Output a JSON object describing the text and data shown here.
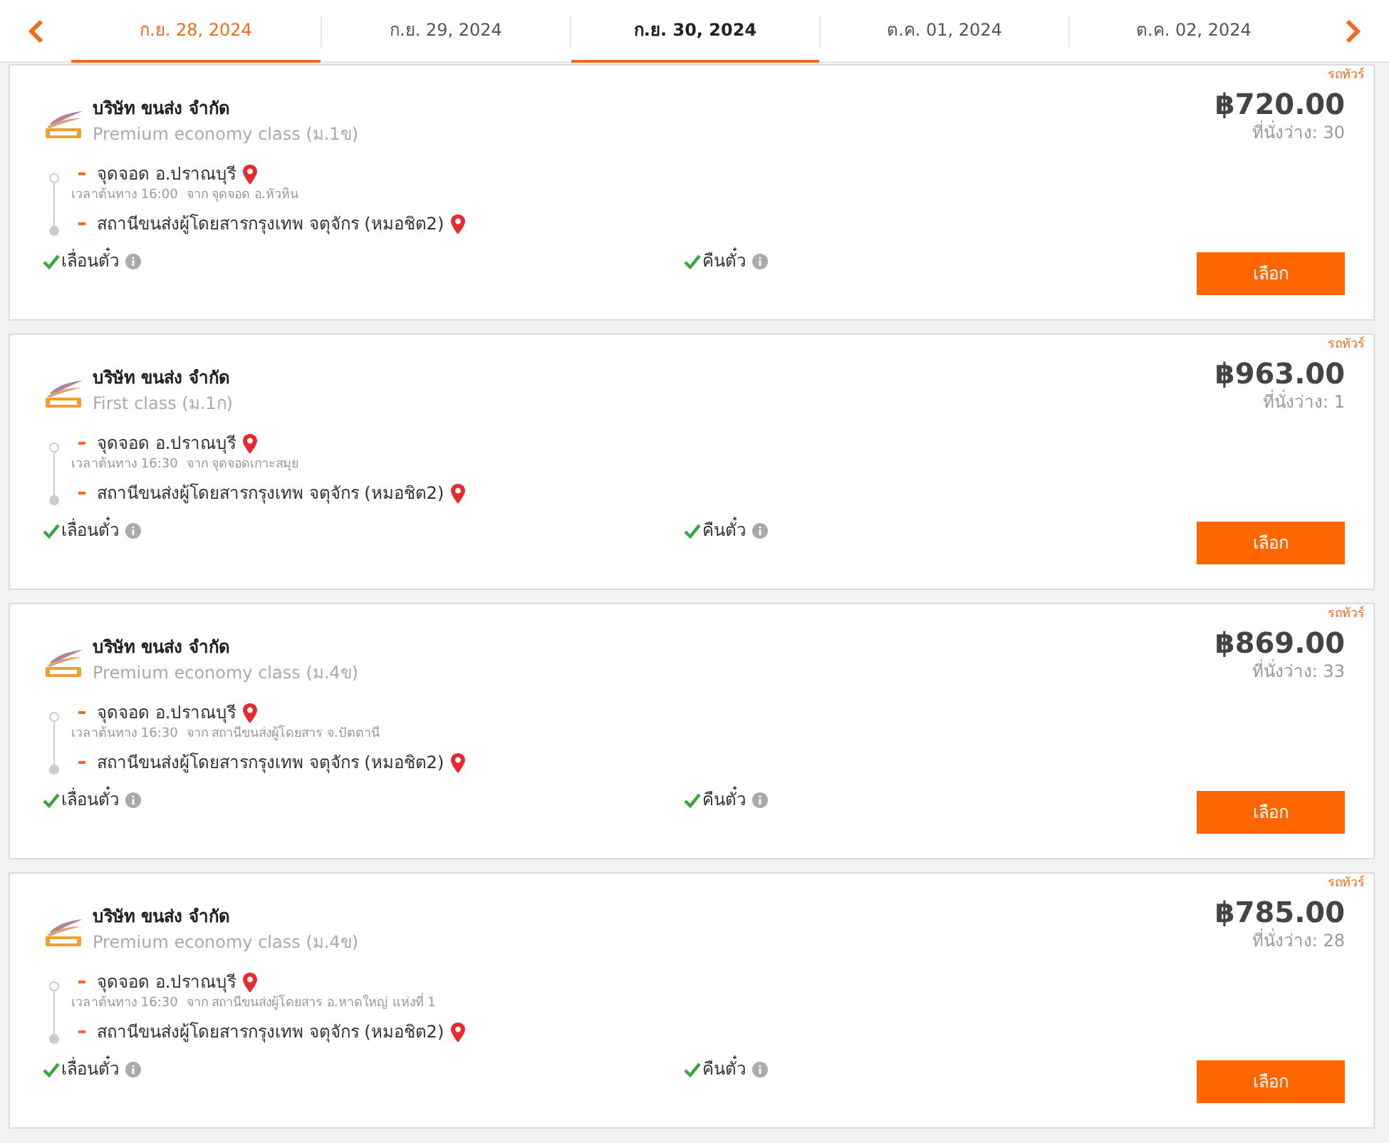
{
  "date_tabs": [
    {
      "label": "ก.ย. 28, 2024",
      "selected": false,
      "highlighted": true
    },
    {
      "label": "ก.ย. 29, 2024",
      "selected": false,
      "highlighted": false
    },
    {
      "label": "ก.ย. 30, 2024",
      "selected": true,
      "highlighted": false
    },
    {
      "label": "ต.ค. 01, 2024",
      "selected": false,
      "highlighted": false
    },
    {
      "label": "ต.ค. 02, 2024",
      "selected": false,
      "highlighted": false
    }
  ],
  "trips": [
    {
      "tag": "รถทัวร์",
      "company": "บริษัท ขนส่ง จำกัด",
      "class": "Premium economy class (ม.1ข)",
      "price": "฿720.00",
      "seats": "ที่นั่งว่าง: 30",
      "origin": "จุดจอด อ.ปราณบุรี",
      "departure": "เวลาต้นทาง 16:00",
      "from": "จาก จุดจอด อ.หัวหิน",
      "destination": "สถานีขนส่งผู้โดยสารกรุงเทพ จตุจักร (หมอชิต2)",
      "features": [
        {
          "label": "เลื่อนตั๋ว",
          "checked": true
        },
        {
          "label": "คืนตั๋ว",
          "checked": true
        }
      ],
      "button": "เลือก"
    },
    {
      "tag": "รถทัวร์",
      "company": "บริษัท ขนส่ง จำกัด",
      "class": "First class (ม.1ก)",
      "price": "฿963.00",
      "seats": "ที่นั่งว่าง: 1",
      "origin": "จุดจอด อ.ปราณบุรี",
      "departure": "เวลาต้นทาง 16:30",
      "from": "จาก จุดจอดเกาะสมุย",
      "destination": "สถานีขนส่งผู้โดยสารกรุงเทพ จตุจักร (หมอชิต2)",
      "features": [
        {
          "label": "เลื่อนตั๋ว",
          "checked": true
        },
        {
          "label": "คืนตั๋ว",
          "checked": true
        }
      ],
      "button": "เลือก"
    },
    {
      "tag": "รถทัวร์",
      "company": "บริษัท ขนส่ง จำกัด",
      "class": "Premium economy class (ม.4ข)",
      "price": "฿869.00",
      "seats": "ที่นั่งว่าง: 33",
      "origin": "จุดจอด อ.ปราณบุรี",
      "departure": "เวลาต้นทาง 16:30",
      "from": "จาก สถานีขนส่งผู้โดยสาร จ.ปัตตานี",
      "destination": "สถานีขนส่งผู้โดยสารกรุงเทพ จตุจักร (หมอชิต2)",
      "features": [
        {
          "label": "เลื่อนตั๋ว",
          "checked": true
        },
        {
          "label": "คืนตั๋ว",
          "checked": true
        }
      ],
      "button": "เลือก"
    },
    {
      "tag": "รถทัวร์",
      "company": "บริษัท ขนส่ง จำกัด",
      "class": "Premium economy class (ม.4ข)",
      "price": "฿785.00",
      "seats": "ที่นั่งว่าง: 28",
      "origin": "จุดจอด อ.ปราณบุรี",
      "departure": "เวลาต้นทาง 16:30",
      "from": "จาก สถานีขนส่งผู้โดยสาร อ.หาดใหญ่ แห่งที่ 1",
      "destination": "สถานีขนส่งผู้โดยสารกรุงเทพ จตุจักร (หมอชิต2)",
      "features": [
        {
          "label": "เลื่อนตั๋ว",
          "checked": true
        },
        {
          "label": "คืนตั๋ว",
          "checked": true
        }
      ],
      "button": "เลือก"
    }
  ]
}
